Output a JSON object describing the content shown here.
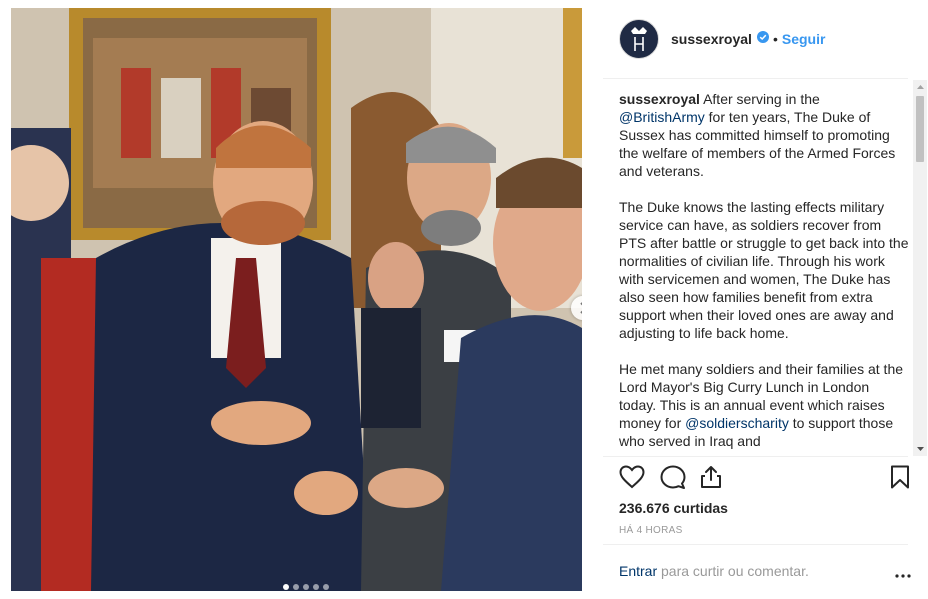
{
  "post": {
    "username": "sussexroyal",
    "separator": "•",
    "follow_label": "Seguir",
    "caption_paragraphs": [
      [
        {
          "type": "user",
          "text": "sussexroyal"
        },
        {
          "type": "text",
          "text": " After serving in the "
        },
        {
          "type": "mention",
          "text": "@BritishArmy"
        },
        {
          "type": "text",
          "text": " for ten years, The Duke of Sussex has committed himself to promoting the welfare of members of the Armed Forces and veterans."
        }
      ],
      [
        {
          "type": "text",
          "text": "The Duke knows the lasting effects military service can have, as soldiers recover from PTS after battle or struggle to get back into the normalities of civilian life. Through his work with servicemen and women, The Duke has also seen how families benefit from extra support when their loved ones are away and adjusting to life back home."
        }
      ],
      [
        {
          "type": "text",
          "text": "He met many soldiers and their families at the Lord Mayor's Big Curry Lunch in London today. This is an annual event which raises money for "
        },
        {
          "type": "mention",
          "text": "@soldierscharity"
        },
        {
          "type": "text",
          "text": " to support those who served in Iraq and"
        }
      ]
    ],
    "likes_text": "236.676 curtidas",
    "time_text": "HÁ 4 HORAS",
    "login_label": "Entrar",
    "comment_prompt": " para curtir ou comentar.",
    "carousel": {
      "count": 5,
      "active": 0
    },
    "icons": {
      "like": "heart-icon",
      "comment": "comment-icon",
      "share": "share-icon",
      "save": "bookmark-icon",
      "verified": "verified-badge-icon",
      "next": "chevron-right-icon",
      "more": "more-options-icon"
    },
    "colors": {
      "link": "#3897f0",
      "mention": "#003569",
      "text": "#262626",
      "muted": "#999999"
    }
  }
}
